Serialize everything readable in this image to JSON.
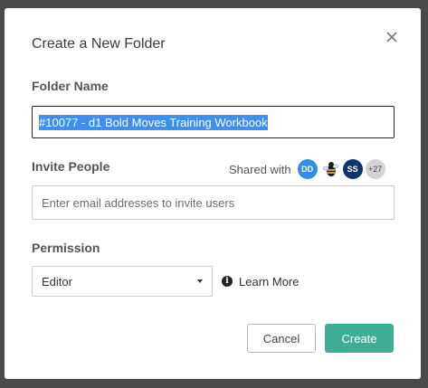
{
  "dialog": {
    "title": "Create a New Folder"
  },
  "folder_name": {
    "label": "Folder Name",
    "value": "#10077 - d1 Bold Moves Training Workbook"
  },
  "invite": {
    "label": "Invite People",
    "shared_with_label": "Shared with",
    "avatars": [
      {
        "initials": "DD",
        "color": "#2f8ee8"
      },
      {
        "initials": "",
        "icon": "bee-mascot-icon"
      },
      {
        "initials": "SS",
        "color": "#10356c"
      },
      {
        "initials": "+27",
        "color": "#d4d4d4"
      }
    ],
    "placeholder": "Enter email addresses to invite users"
  },
  "permission": {
    "label": "Permission",
    "selected": "Editor",
    "learn_more": "Learn More"
  },
  "actions": {
    "cancel_label": "Cancel",
    "create_label": "Create",
    "accent": "#3eae95"
  }
}
